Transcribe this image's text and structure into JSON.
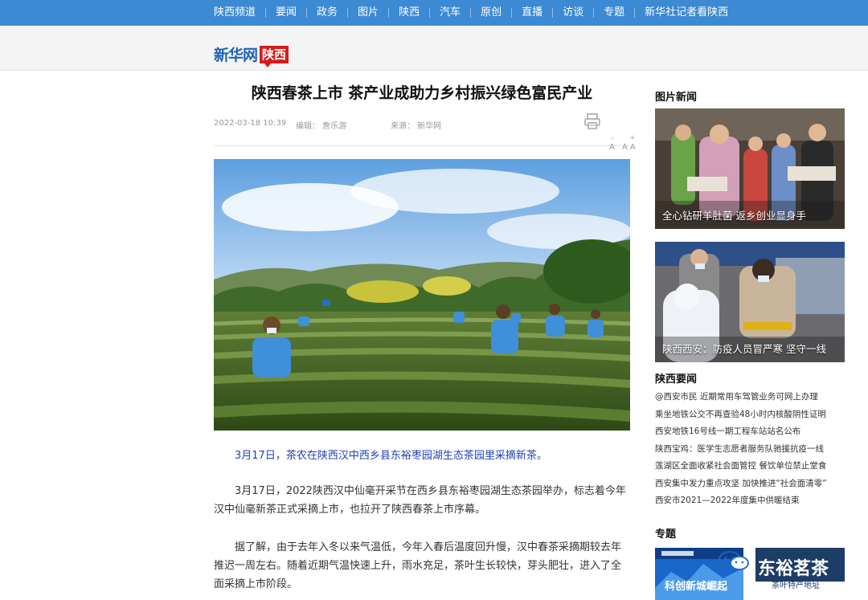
{
  "nav": {
    "items": [
      "陕西频道",
      "要闻",
      "政务",
      "图片",
      "陕西",
      "汽车",
      "原创",
      "直播",
      "访谈",
      "专题",
      "新华社记者看陕西"
    ]
  },
  "logo": {
    "main": "新华网",
    "sub": "陕西"
  },
  "article": {
    "title": "陕西春茶上市 茶产业成助力乡村振兴绿色富民产业",
    "date": "2022-03-18 10:39",
    "editor": "编辑：  詹乐游",
    "source": "来源：  新华网",
    "font_small": "A",
    "font_mid": "A",
    "font_large": "A",
    "font_plus": "+",
    "font_minus": "-",
    "caption": "3月17日，茶农在陕西汉中西乡县东裕枣园湖生态茶园里采摘新茶。",
    "para1": "3月17日，2022陕西汉中仙毫开采节在西乡县东裕枣园湖生态茶园举办，标志着今年汉中仙毫新茶正式采摘上市，也拉开了陕西春茶上市序幕。",
    "para2": "据了解，由于去年入冬以来气温低，今年入春后温度回升慢，汉中春茶采摘期较去年推迟一周左右。随着近期气温快速上升，雨水充足，茶叶生长较快，芽头肥壮，进入了全面采摘上市阶段。"
  },
  "sidebar": {
    "pic_news_title": "图片新闻",
    "pic1_caption": "全心钻研羊肚菌 返乡创业显身手",
    "pic2_caption": "陕西西安：防疫人员冒严寒 坚守一线",
    "news_title": "陕西要闻",
    "news": [
      "@西安市民 近期常用车驾管业务可网上办理",
      "乘坐地铁公交不再查验48小时内核酸阴性证明",
      "西安地铁16号线一期工程车站站名公布",
      "陕西宝鸡：医学生志愿者服务队驰援抗疫一线",
      "莲湖区全面收紧社会面管控 餐饮单位禁止堂食",
      "西安集中发力重点攻坚 加快推进“社会面清零”",
      "西安市2021—2022年度集中供暖结束"
    ],
    "topic_title": "专题",
    "topic1_text": "科创新城崛起",
    "topic2_text": "东裕茗茶",
    "topic2_sub": "茶叶特产地址"
  }
}
